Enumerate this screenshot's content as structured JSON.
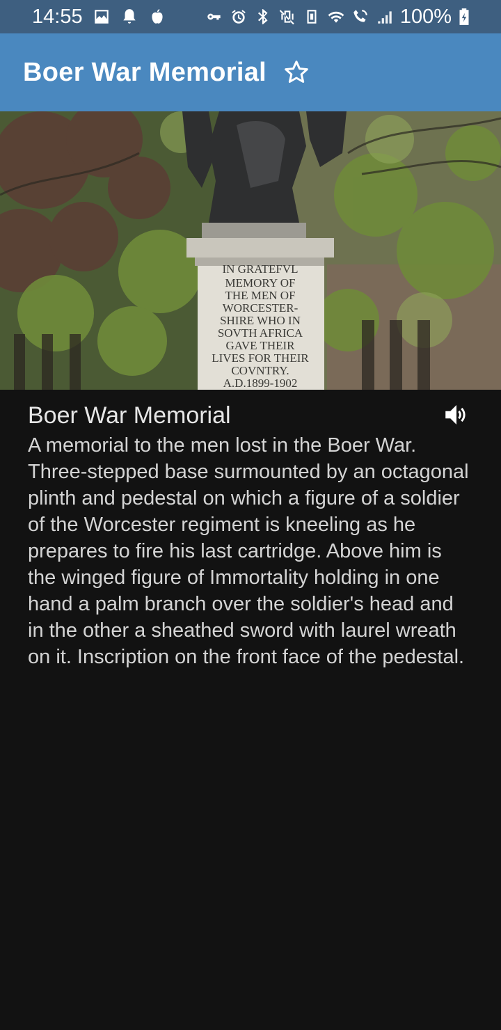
{
  "status_bar": {
    "time": "14:55",
    "battery": "100%",
    "left_icons": [
      "image-icon",
      "bell-icon",
      "apple-icon"
    ],
    "right_icons": [
      "vpn-key-icon",
      "alarm-icon",
      "bluetooth-icon",
      "mute-vibrate-icon",
      "nfc-icon",
      "wifi-icon",
      "wifi-call-icon",
      "signal-icon"
    ]
  },
  "app_bar": {
    "title": "Boer War Memorial",
    "favorite_icon": "star-outline-icon"
  },
  "hero": {
    "plaque_lines": [
      "IN GRATEFVL",
      "MEMORY OF",
      "THE MEN OF",
      "WORCESTER-",
      "SHIRE WHO IN",
      "SOVTH AFRICA",
      "GAVE THEIR",
      "LIVES FOR THEIR",
      "COVNTRY.",
      "A.D.1899-1902"
    ]
  },
  "content": {
    "title": "Boer War Memorial",
    "speaker_icon": "volume-icon",
    "description": "A memorial to the men lost in the Boer War.  Three-stepped base surmounted by an octagonal plinth and pedestal on which a figure of a soldier of the Worcester regiment is kneeling as he prepares to fire his last cartridge. Above him is the winged figure of Immortality holding in one hand a palm branch over the soldier's head and in the other a sheathed sword with laurel wreath on it. Inscription on the front face of the pedestal."
  },
  "colors": {
    "status_bar": "#3e5f80",
    "app_bar": "#4a88bf",
    "background": "#121212",
    "text": "#d9d9d9"
  }
}
